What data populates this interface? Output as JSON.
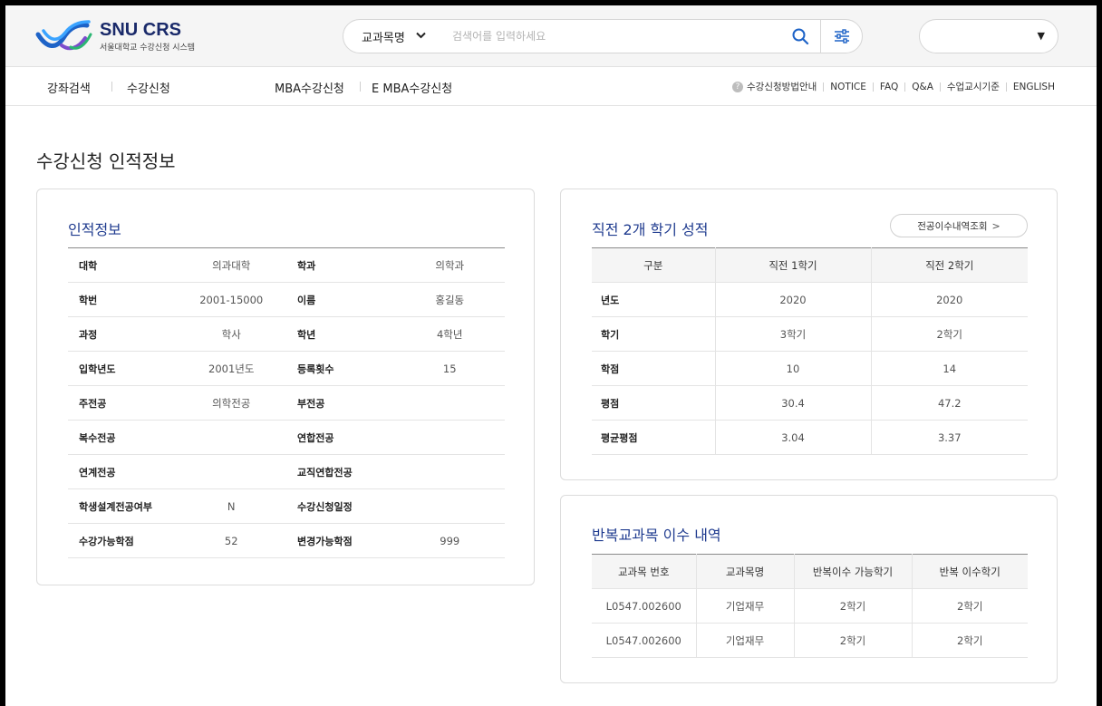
{
  "header": {
    "logo_title": "SNU CRS",
    "logo_subtitle": "서울대학교 수강신청 시스템",
    "search_category": "교과목명",
    "search_placeholder": "검색어를 입력하세요"
  },
  "nav": {
    "items": [
      "강좌검색",
      "수강신청",
      "MBA수강신청",
      "E MBA수강신청"
    ],
    "utility": [
      "수강신청방법안내",
      "NOTICE",
      "FAQ",
      "Q&A",
      "수업교시기준",
      "ENGLISH"
    ]
  },
  "page_title": "수강신청 인적정보",
  "personal": {
    "title": "인적정보",
    "rows": [
      [
        "대학",
        "의과대학",
        "학과",
        "의학과"
      ],
      [
        "학번",
        "2001-15000",
        "이름",
        "홍길동"
      ],
      [
        "과정",
        "학사",
        "학년",
        "4학년"
      ],
      [
        "입학년도",
        "2001년도",
        "등록횟수",
        "15"
      ],
      [
        "주전공",
        "의학전공",
        "부전공",
        ""
      ],
      [
        "복수전공",
        "",
        "연합전공",
        ""
      ],
      [
        "연계전공",
        "",
        "교직연합전공",
        ""
      ],
      [
        "학생설계전공여부",
        "N",
        "수강신청일정",
        ""
      ],
      [
        "수강가능학점",
        "52",
        "변경가능학점",
        "999"
      ]
    ]
  },
  "grades": {
    "title": "직전 2개 학기 성적",
    "history_button": "전공이수내역조회",
    "headers": [
      "구분",
      "직전 1학기",
      "직전 2학기"
    ],
    "rows": [
      [
        "년도",
        "2020",
        "2020"
      ],
      [
        "학기",
        "3학기",
        "2학기"
      ],
      [
        "학점",
        "10",
        "14"
      ],
      [
        "평점",
        "30.4",
        "47.2"
      ],
      [
        "평균평점",
        "3.04",
        "3.37"
      ]
    ]
  },
  "repeat": {
    "title": "반복교과목 이수 내역",
    "headers": [
      "교과목 번호",
      "교과목명",
      "반복이수 가능학기",
      "반복 이수학기"
    ],
    "rows": [
      [
        "L0547.002600",
        "기업재무",
        "2학기",
        "2학기"
      ],
      [
        "L0547.002600",
        "기업재무",
        "2학기",
        "2학기"
      ]
    ]
  },
  "colors": {
    "accent": "#1f3b8f",
    "logo_blue": "#1a2a6a"
  }
}
